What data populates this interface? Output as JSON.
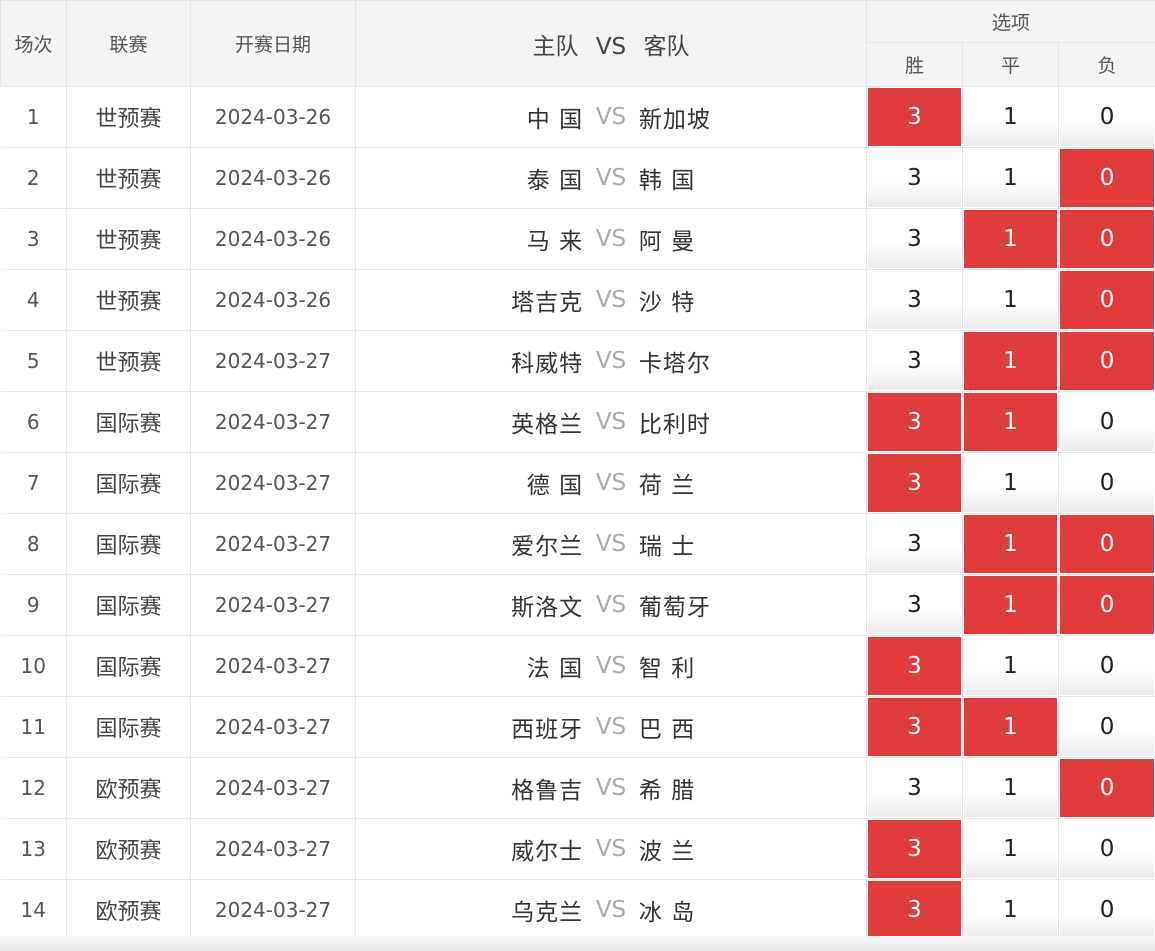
{
  "header": {
    "no": "场次",
    "league": "联赛",
    "date": "开赛日期",
    "home": "主队",
    "vs": "VS",
    "away": "客队",
    "options": "选项",
    "win": "胜",
    "draw": "平",
    "loss": "负"
  },
  "selected_color": "#e03c3c",
  "rows": [
    {
      "no": "1",
      "league": "世预赛",
      "date": "2024-03-26",
      "home": "中 国",
      "vs": "VS",
      "away": "新加坡",
      "win": "3",
      "draw": "1",
      "loss": "0",
      "win_sel": true,
      "draw_sel": false,
      "loss_sel": false
    },
    {
      "no": "2",
      "league": "世预赛",
      "date": "2024-03-26",
      "home": "泰 国",
      "vs": "VS",
      "away": "韩 国",
      "win": "3",
      "draw": "1",
      "loss": "0",
      "win_sel": false,
      "draw_sel": false,
      "loss_sel": true
    },
    {
      "no": "3",
      "league": "世预赛",
      "date": "2024-03-26",
      "home": "马 来",
      "vs": "VS",
      "away": "阿 曼",
      "win": "3",
      "draw": "1",
      "loss": "0",
      "win_sel": false,
      "draw_sel": true,
      "loss_sel": true
    },
    {
      "no": "4",
      "league": "世预赛",
      "date": "2024-03-26",
      "home": "塔吉克",
      "vs": "VS",
      "away": "沙 特",
      "win": "3",
      "draw": "1",
      "loss": "0",
      "win_sel": false,
      "draw_sel": false,
      "loss_sel": true
    },
    {
      "no": "5",
      "league": "世预赛",
      "date": "2024-03-27",
      "home": "科威特",
      "vs": "VS",
      "away": "卡塔尔",
      "win": "3",
      "draw": "1",
      "loss": "0",
      "win_sel": false,
      "draw_sel": true,
      "loss_sel": true
    },
    {
      "no": "6",
      "league": "国际赛",
      "date": "2024-03-27",
      "home": "英格兰",
      "vs": "VS",
      "away": "比利时",
      "win": "3",
      "draw": "1",
      "loss": "0",
      "win_sel": true,
      "draw_sel": true,
      "loss_sel": false
    },
    {
      "no": "7",
      "league": "国际赛",
      "date": "2024-03-27",
      "home": "德 国",
      "vs": "VS",
      "away": "荷 兰",
      "win": "3",
      "draw": "1",
      "loss": "0",
      "win_sel": true,
      "draw_sel": false,
      "loss_sel": false
    },
    {
      "no": "8",
      "league": "国际赛",
      "date": "2024-03-27",
      "home": "爱尔兰",
      "vs": "VS",
      "away": "瑞 士",
      "win": "3",
      "draw": "1",
      "loss": "0",
      "win_sel": false,
      "draw_sel": true,
      "loss_sel": true
    },
    {
      "no": "9",
      "league": "国际赛",
      "date": "2024-03-27",
      "home": "斯洛文",
      "vs": "VS",
      "away": "葡萄牙",
      "win": "3",
      "draw": "1",
      "loss": "0",
      "win_sel": false,
      "draw_sel": true,
      "loss_sel": true
    },
    {
      "no": "10",
      "league": "国际赛",
      "date": "2024-03-27",
      "home": "法 国",
      "vs": "VS",
      "away": "智 利",
      "win": "3",
      "draw": "1",
      "loss": "0",
      "win_sel": true,
      "draw_sel": false,
      "loss_sel": false
    },
    {
      "no": "11",
      "league": "国际赛",
      "date": "2024-03-27",
      "home": "西班牙",
      "vs": "VS",
      "away": "巴 西",
      "win": "3",
      "draw": "1",
      "loss": "0",
      "win_sel": true,
      "draw_sel": true,
      "loss_sel": false
    },
    {
      "no": "12",
      "league": "欧预赛",
      "date": "2024-03-27",
      "home": "格鲁吉",
      "vs": "VS",
      "away": "希 腊",
      "win": "3",
      "draw": "1",
      "loss": "0",
      "win_sel": false,
      "draw_sel": false,
      "loss_sel": true
    },
    {
      "no": "13",
      "league": "欧预赛",
      "date": "2024-03-27",
      "home": "威尔士",
      "vs": "VS",
      "away": "波 兰",
      "win": "3",
      "draw": "1",
      "loss": "0",
      "win_sel": true,
      "draw_sel": false,
      "loss_sel": false
    },
    {
      "no": "14",
      "league": "欧预赛",
      "date": "2024-03-27",
      "home": "乌克兰",
      "vs": "VS",
      "away": "冰 岛",
      "win": "3",
      "draw": "1",
      "loss": "0",
      "win_sel": true,
      "draw_sel": false,
      "loss_sel": false
    }
  ]
}
